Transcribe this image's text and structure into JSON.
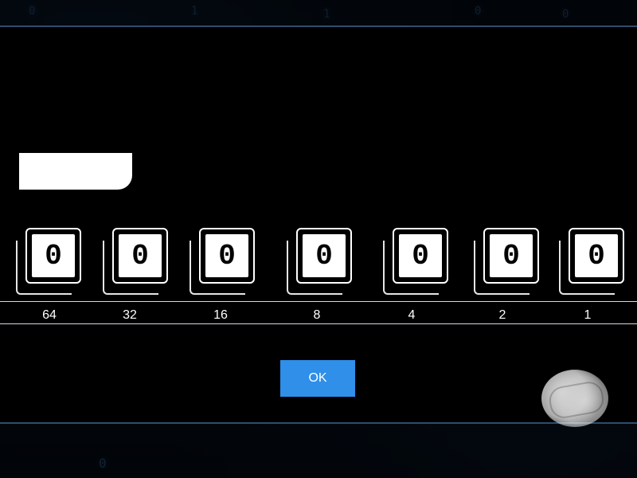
{
  "background": {
    "digits_top": [
      "0",
      "1",
      "1",
      "0",
      "0"
    ],
    "digits_bottom": [
      "0"
    ]
  },
  "bits": [
    "0",
    "0",
    "0",
    "0",
    "0",
    "0",
    "0"
  ],
  "place_values": [
    "64",
    "32",
    "16",
    "8",
    "4",
    "2",
    "1"
  ],
  "ok_button_label": "OK",
  "colors": {
    "ok_button": "#2f8fe9",
    "background_glow": "#58a8ff"
  },
  "icons": {
    "stamp": "seal-icon"
  }
}
